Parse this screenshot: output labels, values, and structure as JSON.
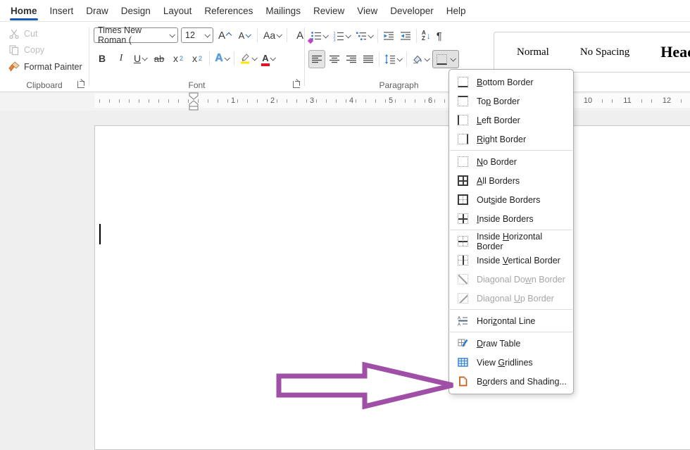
{
  "menubar": {
    "tabs": [
      "Home",
      "Insert",
      "Draw",
      "Design",
      "Layout",
      "References",
      "Mailings",
      "Review",
      "View",
      "Developer",
      "Help"
    ],
    "active_tab": "Home"
  },
  "ribbon": {
    "clipboard": {
      "group_label": "Clipboard",
      "cut_label": "Cut",
      "copy_label": "Copy",
      "format_painter_label": "Format Painter"
    },
    "font": {
      "group_label": "Font",
      "font_name_value": "Times New Roman (",
      "font_size_value": "12",
      "grow": "A",
      "shrink": "A",
      "change_case": "Aa",
      "clear": "A",
      "bold": "B",
      "italic": "I",
      "underline": "U",
      "strikethrough": "ab",
      "sub_base": "x",
      "sub_mark": "2",
      "sup_base": "x",
      "sup_mark": "2",
      "effects": "A",
      "font_color": "A",
      "highlight_color": "#ffe400",
      "font_color_bar": "#e81123"
    },
    "paragraph": {
      "group_label": "Paragraph",
      "pilcrow": "¶",
      "sort_a": "A",
      "sort_z": "Z",
      "sort_arrow": "↓"
    },
    "styles": {
      "items": [
        "Normal",
        "No Spacing",
        "Headi"
      ]
    }
  },
  "ruler": {
    "numbers": [
      "1",
      "2",
      "3",
      "4",
      "5",
      "6",
      "10",
      "11",
      "12"
    ]
  },
  "borders_menu": {
    "items": [
      {
        "pre": "",
        "key": "B",
        "post": "ottom Border"
      },
      {
        "pre": "To",
        "key": "p",
        "post": " Border"
      },
      {
        "pre": "",
        "key": "L",
        "post": "eft Border"
      },
      {
        "pre": "",
        "key": "R",
        "post": "ight Border"
      },
      {
        "pre": "",
        "key": "N",
        "post": "o Border"
      },
      {
        "pre": "",
        "key": "A",
        "post": "ll Borders"
      },
      {
        "pre": "Out",
        "key": "s",
        "post": "ide Borders"
      },
      {
        "pre": "",
        "key": "I",
        "post": "nside Borders"
      },
      {
        "pre": "Inside ",
        "key": "H",
        "post": "orizontal Border"
      },
      {
        "pre": "Inside ",
        "key": "V",
        "post": "ertical Border"
      },
      {
        "pre": "Diagonal Do",
        "key": "w",
        "post": "n Border",
        "disabled": true
      },
      {
        "pre": "Diagonal ",
        "key": "U",
        "post": "p Border",
        "disabled": true
      },
      {
        "pre": "Hori",
        "key": "z",
        "post": "ontal Line"
      },
      {
        "pre": "",
        "key": "D",
        "post": "raw Table"
      },
      {
        "pre": "View ",
        "key": "G",
        "post": "ridlines"
      },
      {
        "pre": "B",
        "key": "o",
        "post": "rders and Shading..."
      }
    ]
  },
  "colors": {
    "accent_blue": "#185abd",
    "arrow_purple": "#a04fa6",
    "highlight_yellow": "#ffe400",
    "font_color_red": "#e81123",
    "disabled_gray": "#a6a6a6"
  }
}
